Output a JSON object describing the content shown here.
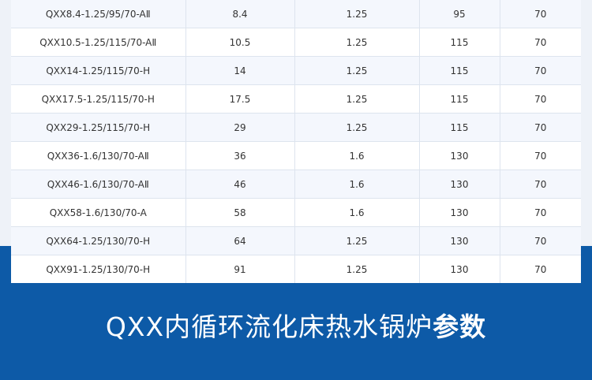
{
  "table": {
    "rows": [
      [
        "QXX8.4-1.25/95/70-AⅡ",
        "8.4",
        "1.25",
        "95",
        "70"
      ],
      [
        "QXX10.5-1.25/115/70-AⅡ",
        "10.5",
        "1.25",
        "115",
        "70"
      ],
      [
        "QXX14-1.25/115/70-H",
        "14",
        "1.25",
        "115",
        "70"
      ],
      [
        "QXX17.5-1.25/115/70-H",
        "17.5",
        "1.25",
        "115",
        "70"
      ],
      [
        "QXX29-1.25/115/70-H",
        "29",
        "1.25",
        "115",
        "70"
      ],
      [
        "QXX36-1.6/130/70-AⅡ",
        "36",
        "1.6",
        "130",
        "70"
      ],
      [
        "QXX46-1.6/130/70-AⅡ",
        "46",
        "1.6",
        "130",
        "70"
      ],
      [
        "QXX58-1.6/130/70-A",
        "58",
        "1.6",
        "130",
        "70"
      ],
      [
        "QXX64-1.25/130/70-H",
        "64",
        "1.25",
        "130",
        "70"
      ],
      [
        "QXX91-1.25/130/70-H",
        "91",
        "1.25",
        "130",
        "70"
      ]
    ]
  },
  "footer": {
    "title_main": "QXX内循环流化床热水锅炉",
    "title_emph": "参数"
  },
  "colors": {
    "band": "#0d5aa7",
    "row_alt": "#f4f7fd",
    "text": "#333333"
  }
}
